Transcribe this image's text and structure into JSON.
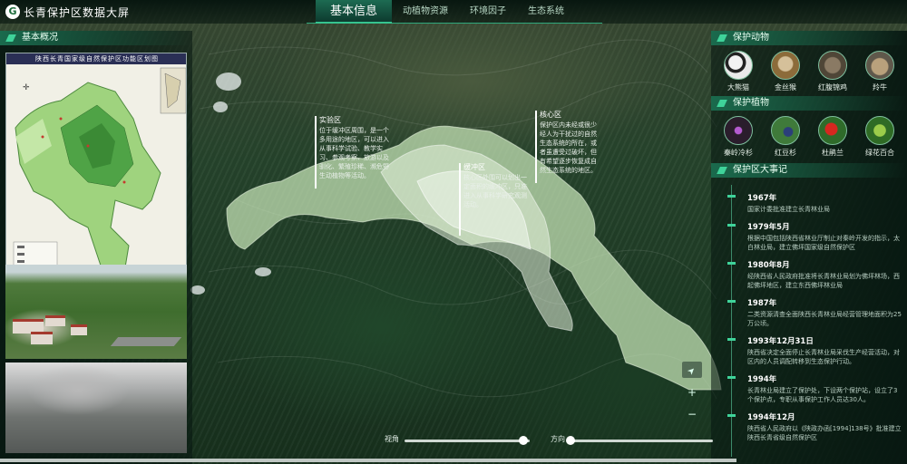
{
  "header": {
    "logo_glyph": "G",
    "title": "长青保护区数据大屏",
    "tabs": [
      {
        "label": "基本信息"
      },
      {
        "label": "动植物资源"
      },
      {
        "label": "环境因子"
      },
      {
        "label": "生态系统"
      }
    ]
  },
  "left_panel": {
    "title": "基本概况",
    "map_title": "陕西长青国家级自然保护区功能区划图"
  },
  "map_callouts": [
    {
      "title": "实验区",
      "text": "位于缓冲区周围，是一个多用途的地区，可以进入从事科学试验、教学实习、参观考察、旅游以及驯化、繁殖珍稀、濒危野生动植物等活动。"
    },
    {
      "title": "缓冲区",
      "text": "核心区外围可以划出一定面积的缓冲区，只准进入从事科学研究观测活动。"
    },
    {
      "title": "核心区",
      "text": "保护区内未经或很少经人为干扰过的自然生态系统的所在，或者虽遭受过破坏，但有希望逐步恢复成自然生态系统的地区。"
    }
  ],
  "right_panel": {
    "animals_title": "保护动物",
    "animals": [
      {
        "name": "大熊猫",
        "icon": "giant-panda"
      },
      {
        "name": "金丝猴",
        "icon": "golden-monkey"
      },
      {
        "name": "红腹锦鸡",
        "icon": "golden-pheasant"
      },
      {
        "name": "羚牛",
        "icon": "takin"
      }
    ],
    "plants_title": "保护植物",
    "plants": [
      {
        "name": "秦岭冷杉",
        "icon": "qinling-fir"
      },
      {
        "name": "红豆杉",
        "icon": "yew"
      },
      {
        "name": "杜鹃兰",
        "icon": "cremastra"
      },
      {
        "name": "绿花百合",
        "icon": "green-lily"
      }
    ],
    "events_title": "保护区大事记",
    "events": [
      {
        "year": "1967年",
        "text": "国家计委批准建立长青林业局"
      },
      {
        "year": "1979年5月",
        "text": "根据中国包括陕西省林业厅制止对秦岭开发的指示，太白林业局，建立佛坪国家级自然保护区"
      },
      {
        "year": "1980年8月",
        "text": "经陕西省人民政府批准将长青林业局划为佛坪林场，西起佛坪地区，建立东西佛坪林业局"
      },
      {
        "year": "1987年",
        "text": "二类资源清查全面陕西长青林业局经营管理地面积为25万公顷。"
      },
      {
        "year": "1993年12月31日",
        "text": "陕西省决定全面停止长青林业局采伐生产经营活动，对区内的人员调配转移到生态保护行动。"
      },
      {
        "year": "1994年",
        "text": "长青林业局建立了保护处，下设两个保护站，设立了3个保护点，专职从事保护工作人员达30人。"
      },
      {
        "year": "1994年12月",
        "text": "陕西省人民政府以《陕政办函[1994]138号》批准建立陕西长青省级自然保护区"
      }
    ]
  },
  "controls": {
    "locate_icon": "➤",
    "zoom_in": "+",
    "zoom_out": "−",
    "view_label": "视角",
    "view_value": 0.95,
    "direction_label": "方向",
    "direction_value": 0.02
  },
  "colors": {
    "accent": "#3fd39a",
    "zone_fill": "#c8e6b8"
  }
}
